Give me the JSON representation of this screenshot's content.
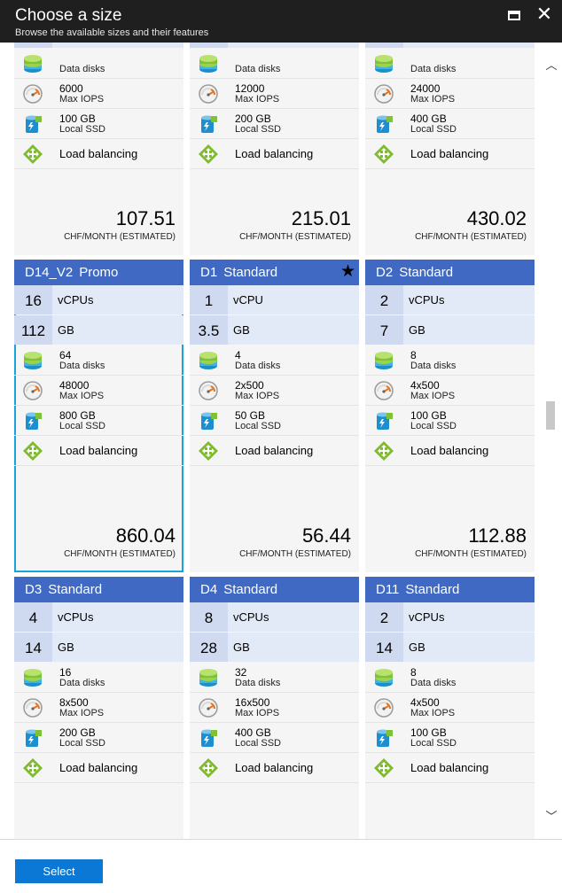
{
  "header": {
    "title": "Choose a size",
    "subtitle": "Browse the available sizes and their features",
    "maximize_icon": "maximize-icon",
    "close_icon": "close-icon",
    "close_glyph": "✕"
  },
  "scrollbar": {
    "up_glyph": "︿",
    "down_glyph": "﹀"
  },
  "colors": {
    "header_bg": "#1f1f1f",
    "card_header": "#3f69c3",
    "spec_row": "#e2e9f7",
    "card_bg": "#f5f5f5",
    "selected_border": "#1aa3d9",
    "select_button": "#0a78d4"
  },
  "cards": [
    {
      "name": "",
      "tier": "",
      "star": "",
      "vcpu_value": "",
      "vcpu_unit": "",
      "mem_value": "",
      "mem_unit": "",
      "disks_value": "",
      "disks_label": "Data disks",
      "iops_value": "6000",
      "iops_label": "Max IOPS",
      "ssd_value": "100 GB",
      "ssd_label": "Local SSD",
      "lb_label": "Load balancing",
      "price": "107.51",
      "price_unit": "CHF/MONTH (ESTIMATED)"
    },
    {
      "name": "",
      "tier": "",
      "star": "",
      "vcpu_value": "",
      "vcpu_unit": "",
      "mem_value": "",
      "mem_unit": "",
      "disks_value": "",
      "disks_label": "Data disks",
      "iops_value": "12000",
      "iops_label": "Max IOPS",
      "ssd_value": "200 GB",
      "ssd_label": "Local SSD",
      "lb_label": "Load balancing",
      "price": "215.01",
      "price_unit": "CHF/MONTH (ESTIMATED)"
    },
    {
      "name": "",
      "tier": "",
      "star": "",
      "vcpu_value": "",
      "vcpu_unit": "",
      "mem_value": "",
      "mem_unit": "",
      "disks_value": "",
      "disks_label": "Data disks",
      "iops_value": "24000",
      "iops_label": "Max IOPS",
      "ssd_value": "400 GB",
      "ssd_label": "Local SSD",
      "lb_label": "Load balancing",
      "price": "430.02",
      "price_unit": "CHF/MONTH (ESTIMATED)"
    },
    {
      "name": "D14_V2",
      "tier": "Promo",
      "star": "",
      "vcpu_value": "16",
      "vcpu_unit": "vCPUs",
      "mem_value": "112",
      "mem_unit": "GB",
      "disks_value": "64",
      "disks_label": "Data disks",
      "iops_value": "48000",
      "iops_label": "Max IOPS",
      "ssd_value": "800 GB",
      "ssd_label": "Local SSD",
      "lb_label": "Load balancing",
      "price": "860.04",
      "price_unit": "CHF/MONTH (ESTIMATED)",
      "selected": true
    },
    {
      "name": "D1",
      "tier": "Standard",
      "star": "★",
      "vcpu_value": "1",
      "vcpu_unit": "vCPU",
      "mem_value": "3.5",
      "mem_unit": "GB",
      "disks_value": "4",
      "disks_label": "Data disks",
      "iops_value": "2x500",
      "iops_label": "Max IOPS",
      "ssd_value": "50 GB",
      "ssd_label": "Local SSD",
      "lb_label": "Load balancing",
      "price": "56.44",
      "price_unit": "CHF/MONTH (ESTIMATED)"
    },
    {
      "name": "D2",
      "tier": "Standard",
      "star": "",
      "vcpu_value": "2",
      "vcpu_unit": "vCPUs",
      "mem_value": "7",
      "mem_unit": "GB",
      "disks_value": "8",
      "disks_label": "Data disks",
      "iops_value": "4x500",
      "iops_label": "Max IOPS",
      "ssd_value": "100 GB",
      "ssd_label": "Local SSD",
      "lb_label": "Load balancing",
      "price": "112.88",
      "price_unit": "CHF/MONTH (ESTIMATED)"
    },
    {
      "name": "D3",
      "tier": "Standard",
      "star": "",
      "vcpu_value": "4",
      "vcpu_unit": "vCPUs",
      "mem_value": "14",
      "mem_unit": "GB",
      "disks_value": "16",
      "disks_label": "Data disks",
      "iops_value": "8x500",
      "iops_label": "Max IOPS",
      "ssd_value": "200 GB",
      "ssd_label": "Local SSD",
      "lb_label": "Load balancing",
      "price": "",
      "price_unit": ""
    },
    {
      "name": "D4",
      "tier": "Standard",
      "star": "",
      "vcpu_value": "8",
      "vcpu_unit": "vCPUs",
      "mem_value": "28",
      "mem_unit": "GB",
      "disks_value": "32",
      "disks_label": "Data disks",
      "iops_value": "16x500",
      "iops_label": "Max IOPS",
      "ssd_value": "400 GB",
      "ssd_label": "Local SSD",
      "lb_label": "Load balancing",
      "price": "",
      "price_unit": ""
    },
    {
      "name": "D11",
      "tier": "Standard",
      "star": "",
      "vcpu_value": "2",
      "vcpu_unit": "vCPUs",
      "mem_value": "14",
      "mem_unit": "GB",
      "disks_value": "8",
      "disks_label": "Data disks",
      "iops_value": "4x500",
      "iops_label": "Max IOPS",
      "ssd_value": "100 GB",
      "ssd_label": "Local SSD",
      "lb_label": "Load balancing",
      "price": "",
      "price_unit": ""
    }
  ],
  "footer": {
    "select_label": "Select"
  }
}
